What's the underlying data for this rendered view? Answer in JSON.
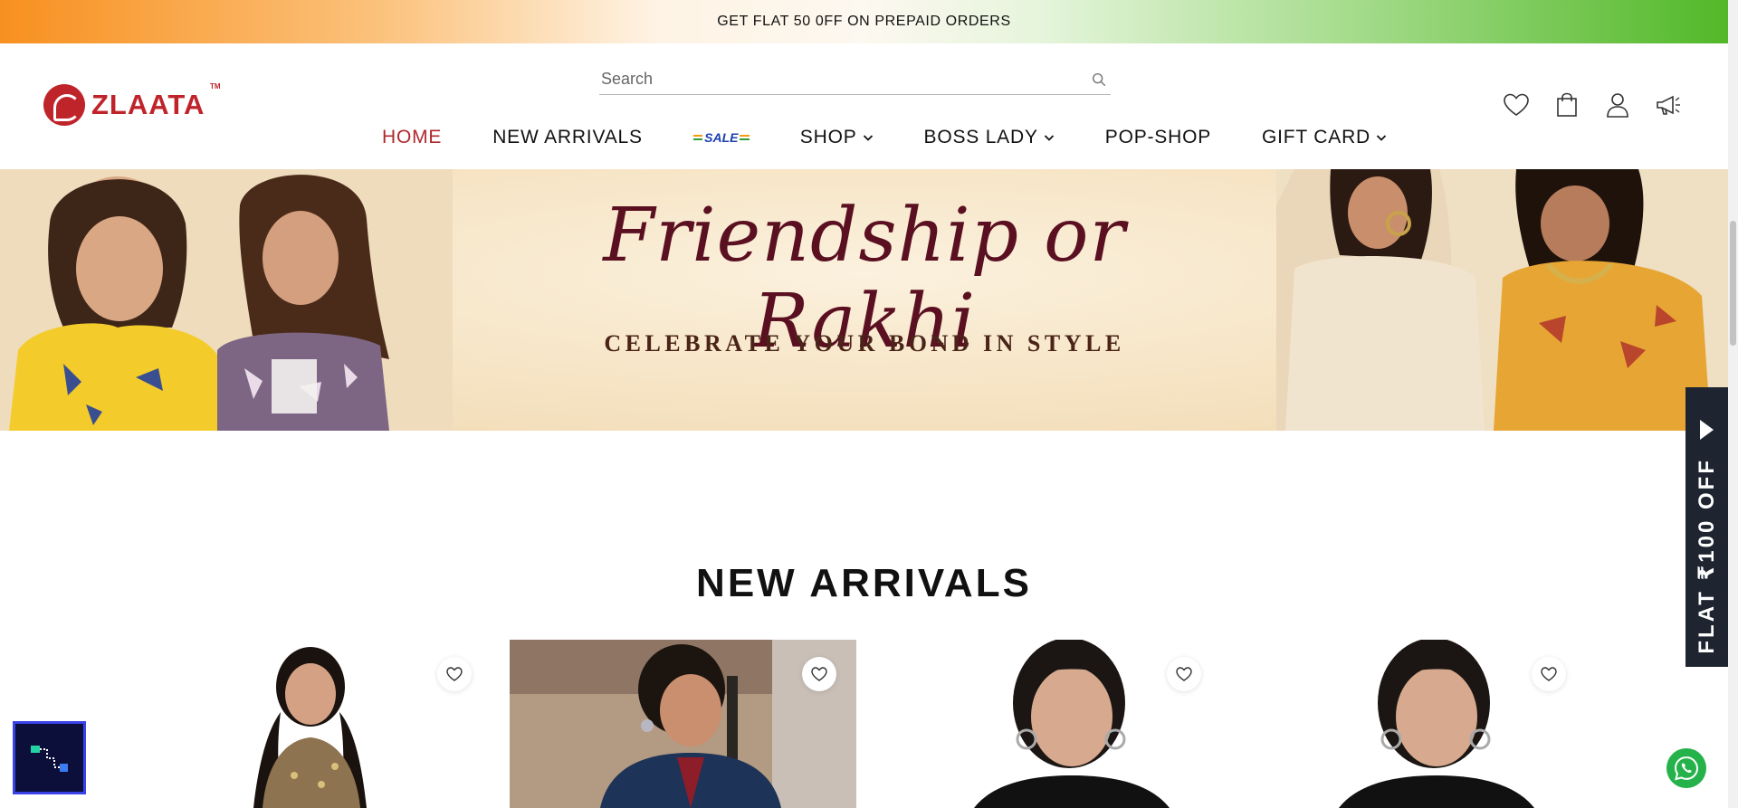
{
  "announcement": {
    "text": "GET FLAT 50 0FF ON PREPAID ORDERS"
  },
  "header": {
    "logo_text": "ZLAATA",
    "logo_tm": "TM",
    "search_placeholder": "Search",
    "nav": [
      {
        "label": "HOME",
        "active": true,
        "dropdown": false
      },
      {
        "label": "NEW ARRIVALS",
        "active": false,
        "dropdown": false
      },
      {
        "label": "SALE",
        "active": false,
        "dropdown": false,
        "badge": true
      },
      {
        "label": "SHOP",
        "active": false,
        "dropdown": true
      },
      {
        "label": "BOSS LADY",
        "active": false,
        "dropdown": true
      },
      {
        "label": "POP-SHOP",
        "active": false,
        "dropdown": false
      },
      {
        "label": "GIFT CARD",
        "active": false,
        "dropdown": true
      }
    ],
    "icons": [
      "heart-icon",
      "bag-icon",
      "user-icon",
      "megaphone-icon"
    ]
  },
  "hero": {
    "title": "Friendship or Rakhi",
    "subtitle": "CELEBRATE YOUR BOND IN STYLE"
  },
  "new_arrivals": {
    "title": "NEW ARRIVALS"
  },
  "side_tab": {
    "label": "FLAT ₹100 OFF"
  },
  "colors": {
    "brand": "#c0242b",
    "nav_active": "#b0282d",
    "hero_text": "#5b1022",
    "side_tab_bg": "#1e2530",
    "whatsapp": "#26b24b"
  }
}
